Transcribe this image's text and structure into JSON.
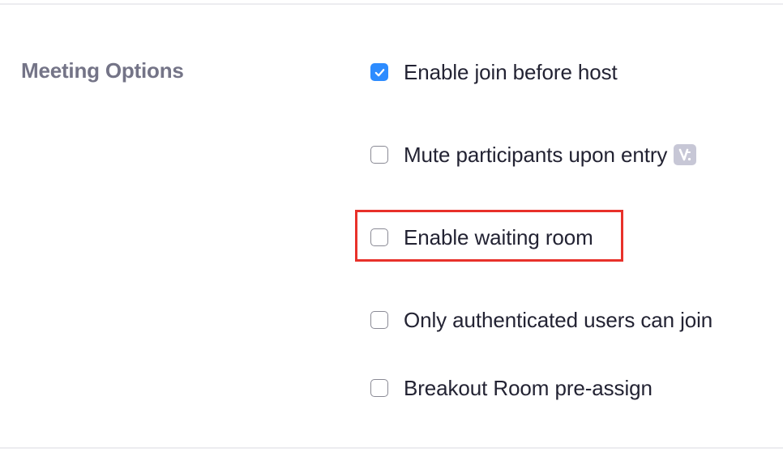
{
  "section": {
    "label": "Meeting Options"
  },
  "options": [
    {
      "label": "Enable join before host",
      "checked": true
    },
    {
      "label": "Mute participants upon entry",
      "checked": false,
      "badge_icon": "v-badge-icon"
    },
    {
      "label": "Enable waiting room",
      "checked": false,
      "highlighted": true
    },
    {
      "label": "Only authenticated users can join",
      "checked": false
    },
    {
      "label": "Breakout Room pre-assign",
      "checked": false
    }
  ],
  "colors": {
    "accent": "#2d8cff",
    "highlight": "#e8312a",
    "label_muted": "#747487",
    "text": "#232333"
  }
}
